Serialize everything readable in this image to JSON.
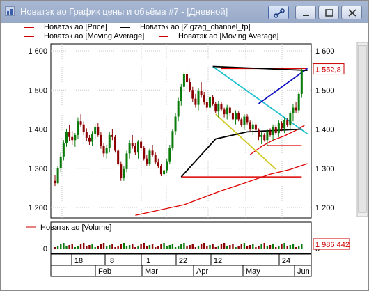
{
  "window": {
    "title": "Новатэк ао График цены и объёма #7 - [Дневной]"
  },
  "legend": [
    {
      "label": "Новатэк ао [Price]",
      "color": "#cc0000"
    },
    {
      "label": "Новатэк ао [Zigzag_channel_tp]",
      "color": "#000000"
    },
    {
      "label": "Новатэк ао [Moving Average]",
      "color": "#cc0000"
    },
    {
      "label": "Новатэк ао [Moving Average]",
      "color": "#cc0000"
    }
  ],
  "volume_legend": {
    "label": "Новатэк ао [Volume]",
    "color": "#cc0000"
  },
  "colors": {
    "up": "#0a7a0a",
    "down": "#8b0000",
    "ma": "#dd0000",
    "zigzag": "#000000",
    "cyan": "#20c0d0",
    "yellow": "#d0c820",
    "blue": "#1010c0"
  },
  "chart_data": {
    "type": "candlestick",
    "price_axis": {
      "ticks": [
        "1 600",
        "1 500",
        "1 400",
        "1 300",
        "1 200"
      ],
      "tick_values": [
        1600,
        1500,
        1400,
        1300,
        1200
      ],
      "ylim": [
        1180,
        1620
      ]
    },
    "last_price_label": "1 552,8",
    "last_price": 1552.8,
    "volume_axis": {
      "ticks": [
        "0"
      ],
      "last_label": "1 986 442"
    },
    "date_axis": {
      "days": [
        "18",
        "8",
        "1",
        "22",
        "12",
        "24"
      ],
      "months": [
        "Feb",
        "Mar",
        "Apr",
        "May",
        "Jun"
      ]
    },
    "candles": [
      [
        1268,
        1255,
        1282,
        1262
      ],
      [
        1262,
        1258,
        1305,
        1300
      ],
      [
        1300,
        1290,
        1340,
        1330
      ],
      [
        1330,
        1320,
        1372,
        1365
      ],
      [
        1365,
        1355,
        1400,
        1392
      ],
      [
        1392,
        1370,
        1410,
        1380
      ],
      [
        1380,
        1360,
        1395,
        1372
      ],
      [
        1372,
        1355,
        1390,
        1385
      ],
      [
        1385,
        1375,
        1430,
        1420
      ],
      [
        1420,
        1405,
        1438,
        1412
      ],
      [
        1412,
        1385,
        1420,
        1392
      ],
      [
        1392,
        1370,
        1402,
        1378
      ],
      [
        1378,
        1360,
        1385,
        1368
      ],
      [
        1368,
        1358,
        1395,
        1388
      ],
      [
        1388,
        1375,
        1412,
        1405
      ],
      [
        1405,
        1380,
        1415,
        1385
      ],
      [
        1385,
        1350,
        1392,
        1358
      ],
      [
        1358,
        1330,
        1365,
        1338
      ],
      [
        1338,
        1325,
        1360,
        1352
      ],
      [
        1352,
        1340,
        1392,
        1385
      ],
      [
        1385,
        1372,
        1400,
        1380
      ],
      [
        1380,
        1340,
        1385,
        1345
      ],
      [
        1345,
        1305,
        1350,
        1310
      ],
      [
        1310,
        1268,
        1318,
        1275
      ],
      [
        1275,
        1268,
        1305,
        1298
      ],
      [
        1298,
        1290,
        1345,
        1338
      ],
      [
        1338,
        1325,
        1372,
        1365
      ],
      [
        1365,
        1350,
        1385,
        1358
      ],
      [
        1358,
        1335,
        1365,
        1340
      ],
      [
        1340,
        1325,
        1372,
        1368
      ],
      [
        1368,
        1345,
        1380,
        1352
      ],
      [
        1352,
        1320,
        1358,
        1325
      ],
      [
        1325,
        1305,
        1335,
        1312
      ],
      [
        1312,
        1305,
        1350,
        1345
      ],
      [
        1345,
        1330,
        1360,
        1335
      ],
      [
        1335,
        1310,
        1340,
        1315
      ],
      [
        1315,
        1300,
        1325,
        1305
      ],
      [
        1305,
        1280,
        1312,
        1285
      ],
      [
        1285,
        1278,
        1300,
        1295
      ],
      [
        1295,
        1288,
        1325,
        1318
      ],
      [
        1318,
        1310,
        1360,
        1352
      ],
      [
        1352,
        1345,
        1400,
        1395
      ],
      [
        1395,
        1385,
        1440,
        1432
      ],
      [
        1432,
        1420,
        1480,
        1472
      ],
      [
        1472,
        1460,
        1515,
        1508
      ],
      [
        1508,
        1495,
        1545,
        1540
      ],
      [
        1540,
        1510,
        1560,
        1520
      ],
      [
        1520,
        1495,
        1530,
        1500
      ],
      [
        1500,
        1470,
        1508,
        1478
      ],
      [
        1478,
        1455,
        1490,
        1462
      ],
      [
        1462,
        1448,
        1505,
        1498
      ],
      [
        1498,
        1480,
        1520,
        1488
      ],
      [
        1488,
        1462,
        1495,
        1470
      ],
      [
        1470,
        1445,
        1478,
        1455
      ],
      [
        1455,
        1440,
        1490,
        1482
      ],
      [
        1482,
        1460,
        1488,
        1465
      ],
      [
        1465,
        1440,
        1470,
        1445
      ],
      [
        1445,
        1430,
        1472,
        1465
      ],
      [
        1465,
        1445,
        1470,
        1450
      ],
      [
        1450,
        1430,
        1455,
        1438
      ],
      [
        1438,
        1425,
        1462,
        1455
      ],
      [
        1455,
        1435,
        1460,
        1440
      ],
      [
        1440,
        1418,
        1445,
        1425
      ],
      [
        1425,
        1412,
        1448,
        1440
      ],
      [
        1440,
        1420,
        1445,
        1425
      ],
      [
        1425,
        1405,
        1430,
        1410
      ],
      [
        1410,
        1398,
        1438,
        1432
      ],
      [
        1432,
        1412,
        1438,
        1418
      ],
      [
        1418,
        1395,
        1422,
        1400
      ],
      [
        1400,
        1385,
        1420,
        1412
      ],
      [
        1412,
        1392,
        1418,
        1398
      ],
      [
        1398,
        1372,
        1402,
        1380
      ],
      [
        1380,
        1362,
        1392,
        1385
      ],
      [
        1385,
        1368,
        1390,
        1372
      ],
      [
        1372,
        1358,
        1400,
        1395
      ],
      [
        1395,
        1380,
        1402,
        1385
      ],
      [
        1385,
        1372,
        1412,
        1405
      ],
      [
        1405,
        1385,
        1410,
        1390
      ],
      [
        1390,
        1380,
        1422,
        1415
      ],
      [
        1415,
        1395,
        1420,
        1402
      ],
      [
        1402,
        1390,
        1430,
        1424
      ],
      [
        1424,
        1405,
        1428,
        1410
      ],
      [
        1410,
        1400,
        1445,
        1440
      ],
      [
        1440,
        1420,
        1465,
        1455
      ],
      [
        1455,
        1440,
        1470,
        1448
      ],
      [
        1448,
        1440,
        1495,
        1490
      ],
      [
        1490,
        1480,
        1555,
        1550
      ]
    ],
    "ma_series": [
      {
        "name": "Moving Average",
        "points": [
          [
            28,
            1180
          ],
          [
            45,
            1207
          ],
          [
            57,
            1240
          ],
          [
            66,
            1262
          ],
          [
            75,
            1285
          ],
          [
            82,
            1297
          ],
          [
            88,
            1312
          ]
        ]
      },
      {
        "name": "Moving Average",
        "points": [
          [
            68,
            1335
          ],
          [
            72,
            1356
          ],
          [
            76,
            1372
          ],
          [
            80,
            1383
          ],
          [
            84,
            1397
          ],
          [
            87,
            1410
          ]
        ]
      }
    ],
    "zigzag": [
      [
        [
          44,
          1278
        ],
        [
          56,
          1375
        ],
        [
          67,
          1393
        ],
        [
          86,
          1400
        ]
      ],
      [
        [
          55,
          1560
        ],
        [
          88,
          1550
        ]
      ]
    ],
    "cyan_line": [
      [
        55,
        1560
      ],
      [
        88,
        1388
      ]
    ],
    "yellow_line": [
      [
        56,
        1438
      ],
      [
        77,
        1298
      ]
    ],
    "blue_line": [
      [
        71,
        1465
      ],
      [
        88,
        1555
      ]
    ],
    "support_levels": [
      {
        "value": 1555,
        "from": 58,
        "to": 88
      },
      {
        "value": 1358,
        "from": 74,
        "to": 86
      },
      {
        "value": 1278,
        "from": 44,
        "to": 86
      }
    ]
  }
}
